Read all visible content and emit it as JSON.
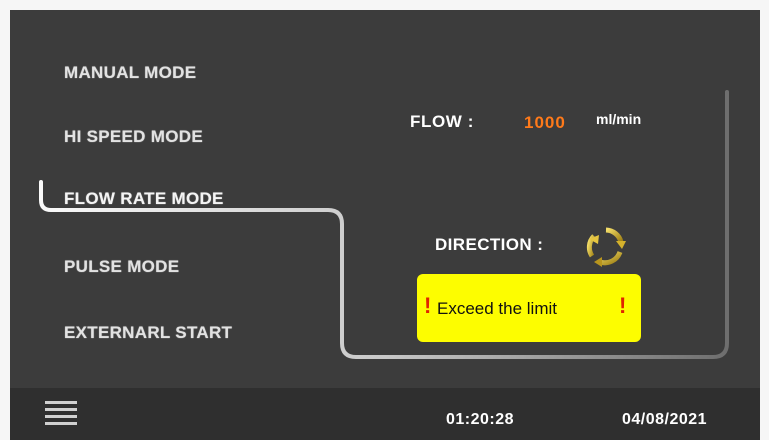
{
  "modes": [
    {
      "label": "MANUAL MODE",
      "active": false
    },
    {
      "label": "HI SPEED MODE",
      "active": false
    },
    {
      "label": "FLOW RATE MODE",
      "active": true
    },
    {
      "label": "PULSE MODE",
      "active": false
    },
    {
      "label": "EXTERNARL START",
      "active": false
    }
  ],
  "flow": {
    "label": "FLOW :",
    "value": "1000",
    "unit": "ml/min",
    "value_color": "#ff7a1a"
  },
  "direction": {
    "label": "DIRECTION :",
    "icon": "rotate-arrows-icon"
  },
  "warning": {
    "text": "Exceed the limit",
    "background": "#fdfd00",
    "icon": "exclamation-icon"
  },
  "status_bar": {
    "menu_icon": "hamburger-menu-icon",
    "time": "01:20:28",
    "date": "04/08/2021"
  }
}
